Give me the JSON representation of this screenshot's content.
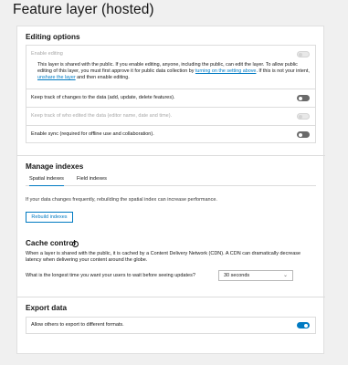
{
  "page": {
    "title": "Feature layer (hosted)"
  },
  "editing": {
    "title": "Editing options",
    "enable_editing": {
      "label": "Enable editing",
      "state": "disabled"
    },
    "notice": {
      "text1": "This layer is shared with the public. If you enable editing, anyone, including the public, can edit the layer. To allow public editing of this layer, you must first approve it for public data collection by",
      "link1": "turning on the setting above",
      "text2": ". If this is not your intent,",
      "link2": "unshare the layer",
      "text3": "and then enable editing."
    },
    "track_changes": {
      "label": "Keep track of changes to the data (add, update, delete features).",
      "state": "off"
    },
    "track_who": {
      "label": "Keep track of who edited the data (editor name, date and time).",
      "state": "disabled"
    },
    "enable_sync": {
      "label": "Enable sync (required for offline use and collaboration).",
      "state": "off"
    }
  },
  "indexes": {
    "title": "Manage indexes",
    "tabs": [
      {
        "label": "Spatial indexes",
        "active": true
      },
      {
        "label": "Field indexes",
        "active": false
      }
    ],
    "helper": "If your data changes frequently, rebuilding the spatial index can increase performance.",
    "rebuild_label": "Rebuild indexes"
  },
  "cache": {
    "title": "Cache control",
    "info_glyph": "i",
    "description": "When a layer is shared with the public, it is cached by a Content Delivery Network (CDN). A CDN can dramatically decrease latency when delivering your content around the globe.",
    "question": "What is the longest time you want your users to wait before seeing updates?",
    "select_value": "30 seconds",
    "chevron": "⌄"
  },
  "export": {
    "title": "Export data",
    "allow_label": "Allow others to export to different formats.",
    "allow_state": "on"
  },
  "colors": {
    "accent": "#007ac2",
    "text": "#151515",
    "disabled": "#a8a8a8",
    "border": "#dcdcdc"
  }
}
